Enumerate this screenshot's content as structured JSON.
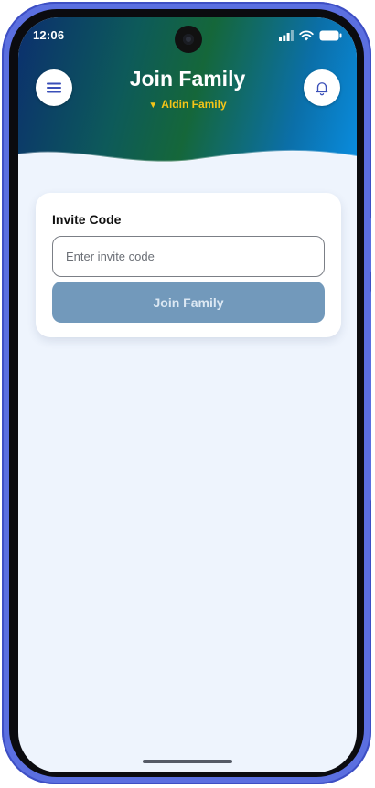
{
  "status_bar": {
    "time": "12:06"
  },
  "header": {
    "title": "Join Family",
    "family_selector": {
      "caret": "▼",
      "label": "Aldin Family"
    },
    "menu_icon": "hamburger-menu-icon",
    "notification_icon": "bell-icon"
  },
  "invite_card": {
    "label": "Invite Code",
    "input": {
      "value": "",
      "placeholder": "Enter invite code"
    },
    "join_button_label": "Join Family"
  },
  "colors": {
    "accent_yellow": "#f5c518",
    "button_disabled": "#7299bb",
    "screen_background": "#eef4fd",
    "frame_blue": "#5b6fe0"
  }
}
